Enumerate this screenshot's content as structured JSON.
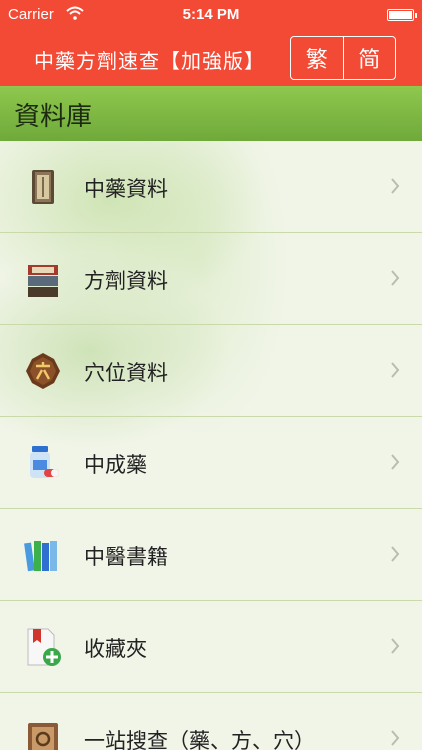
{
  "status": {
    "carrier": "Carrier",
    "time": "5:14 PM",
    "battery_level": 1.0
  },
  "nav": {
    "title": "中藥方劑速查【加強版】",
    "seg_traditional": "繁",
    "seg_simplified": "简"
  },
  "section": {
    "title": "資料庫"
  },
  "items": [
    {
      "label": "中藥資料",
      "icon": "herb-book-icon"
    },
    {
      "label": "方劑資料",
      "icon": "prescription-books-icon"
    },
    {
      "label": "穴位資料",
      "icon": "acupoint-icon"
    },
    {
      "label": "中成藥",
      "icon": "medicine-bottle-icon"
    },
    {
      "label": "中醫書籍",
      "icon": "bookshelf-icon"
    },
    {
      "label": "收藏夾",
      "icon": "bookmark-add-icon"
    },
    {
      "label": "一站搜查（藥、方、穴）",
      "icon": "search-book-icon"
    }
  ]
}
